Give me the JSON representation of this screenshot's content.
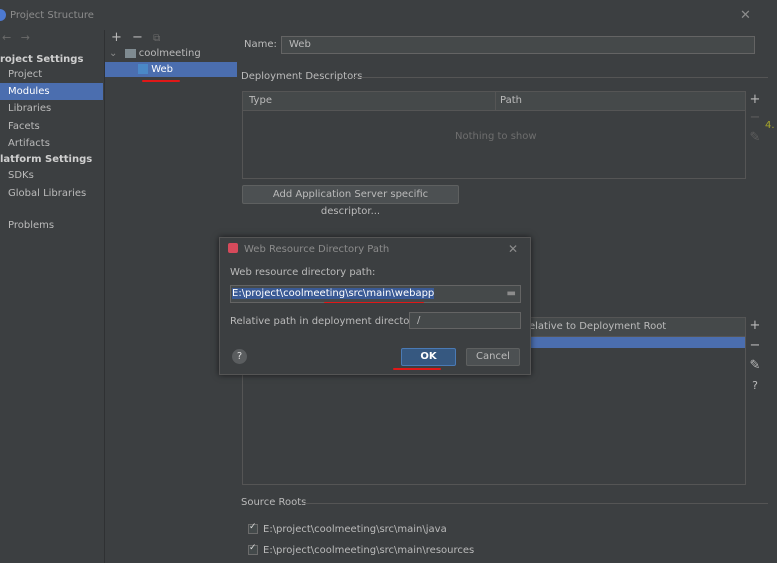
{
  "window": {
    "title": "Project Structure",
    "close_icon": "close-icon"
  },
  "nav": {
    "back": "←",
    "forward": "→"
  },
  "sidebar": {
    "project_settings_header": "roject Settings",
    "items_project": [
      "Project",
      "Modules",
      "Libraries",
      "Facets",
      "Artifacts"
    ],
    "platform_settings_header": "latform Settings",
    "items_platform": [
      "SDKs",
      "Global Libraries"
    ],
    "problems": "Problems",
    "selected": "Modules"
  },
  "tree": {
    "toolbar": {
      "add": "+",
      "remove": "−",
      "copy": "⧉"
    },
    "root": "coolmeeting",
    "child": "Web"
  },
  "module": {
    "name_label": "Name:",
    "name_value": "Web",
    "deployment_descriptors_title": "Deployment Descriptors",
    "dd_columns": [
      "Type",
      "Path"
    ],
    "dd_empty": "Nothing to show",
    "add_descriptor_button": "Add Application Server specific descriptor...",
    "web_root_column": "elative to Deployment Root",
    "source_roots_title": "Source Roots",
    "source_roots": [
      "E:\\project\\coolmeeting\\src\\main\\java",
      "E:\\project\\coolmeeting\\src\\main\\resources"
    ],
    "side_number": "4."
  },
  "dialog": {
    "title": "Web Resource Directory Path",
    "path_label": "Web resource directory path:",
    "path_value": "E:\\project\\coolmeeting\\src\\main\\webapp",
    "relative_label": "Relative path in deployment directory:",
    "relative_value": "/",
    "ok": "OK",
    "cancel": "Cancel",
    "help": "?"
  },
  "colors": {
    "selection": "#4b6eaf",
    "annotation": "#e01818",
    "background": "#3c3f41"
  }
}
